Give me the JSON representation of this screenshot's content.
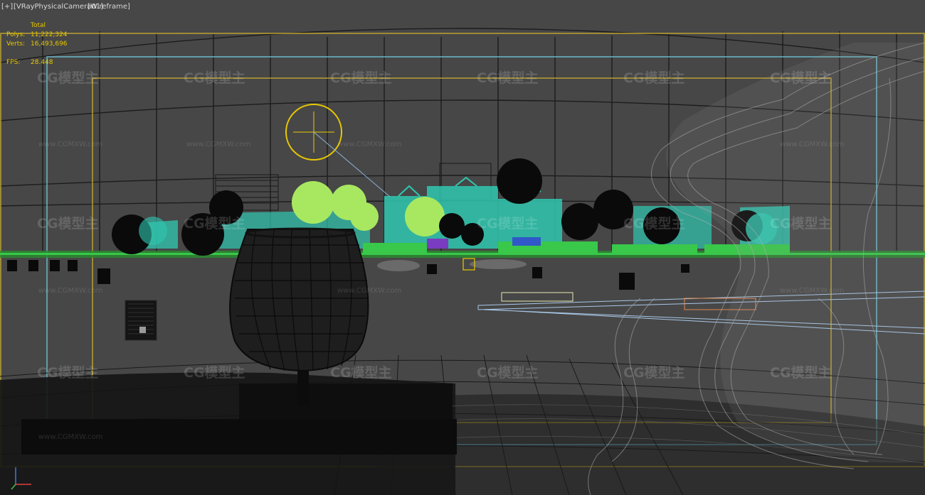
{
  "viewport": {
    "label_plus": "[+]",
    "label_camera": "[VRayPhysicalCamera01]",
    "label_mode": "[Wireframe]"
  },
  "stats": {
    "header": "Total",
    "polys_label": "Polys:",
    "polys_value": "11,222,324",
    "verts_label": "Verts:",
    "verts_value": "16,493,696",
    "fps_label": "FPS:",
    "fps_value": "28.448"
  },
  "watermark": {
    "logo_text": "CG模型主",
    "url_text": "www.CGMXW.com"
  },
  "colors": {
    "viewport_bg": "#474747",
    "stats_text": "#e8c800",
    "safe_frame_yellow": "#b8a030",
    "safe_frame_cyan": "#6ab8c8",
    "foliage_cyan": "#2fc8b0",
    "foliage_lime": "#a8e860",
    "foliage_green": "#39c84a"
  }
}
